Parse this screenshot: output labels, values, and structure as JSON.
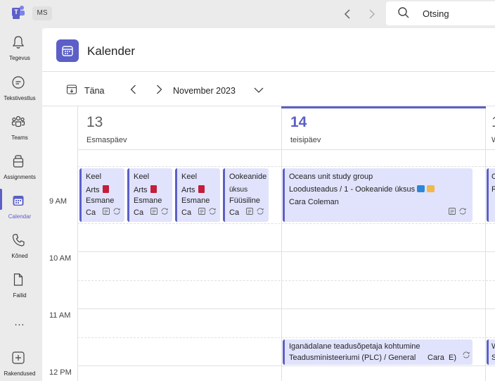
{
  "user": {
    "initials": "MS"
  },
  "search": {
    "placeholder": "Otsing"
  },
  "rail": {
    "items": [
      {
        "label": "Tegevus",
        "icon": "bell-icon"
      },
      {
        "label": "Tekstivestlus",
        "icon": "chat-icon"
      },
      {
        "label": "Teams",
        "icon": "teams-icon"
      },
      {
        "label": "Assignments",
        "icon": "assignments-icon"
      },
      {
        "label": "Calendar",
        "icon": "calendar-icon"
      },
      {
        "label": "Kõned",
        "icon": "phone-icon"
      },
      {
        "label": "Failid",
        "icon": "file-icon"
      },
      {
        "label": "...",
        "icon": "more-icon"
      },
      {
        "label": "Rakendused",
        "icon": "add-icon"
      }
    ],
    "active": "Calendar"
  },
  "header": {
    "title": "Kalender"
  },
  "toolbar": {
    "today_label": "Täna",
    "month_label": "November 2023"
  },
  "days": [
    {
      "number": "13",
      "name": "Esmaspäev"
    },
    {
      "number": "14",
      "name": "teisipäev"
    },
    {
      "number": "1",
      "name": "W"
    }
  ],
  "times": [
    "9 AM",
    "10 AM",
    "11 AM",
    "12 PM"
  ],
  "events": {
    "mon1": {
      "line1": "Keel",
      "line2": "Arts",
      "line3": "Esmane",
      "line4": "Ca"
    },
    "mon2": {
      "line1": "Keel",
      "line2": "Arts",
      "line3": "Esmane",
      "line4": "Ca"
    },
    "mon3": {
      "line1": "Keel",
      "line2": "Arts",
      "line3": "Esmane",
      "line4": "Ca"
    },
    "mon4": {
      "line1": "Ookeanide",
      "line2": "üksus",
      "line3": "Füüsiline",
      "line4": "Ca"
    },
    "tue1": {
      "line1": "Oceans unit study group",
      "line2": "Loodusteadus / 1 - Ookeanide üksus",
      "line3": "Cara Coleman"
    },
    "tue2": {
      "line1": "Iganädalane teadusõpetaja kohtumine",
      "line2": "Teadusministeeriumi (PLC) / General",
      "line3": "Cara",
      "line4": "E)"
    },
    "wed1": {
      "line1": "O",
      "line2": "R"
    },
    "wed2": {
      "line1": "W",
      "line2": "S"
    }
  },
  "colors": {
    "accent": "#5b5fc7",
    "event_bg": "#e1e3fc",
    "book": "#c41e3a"
  }
}
